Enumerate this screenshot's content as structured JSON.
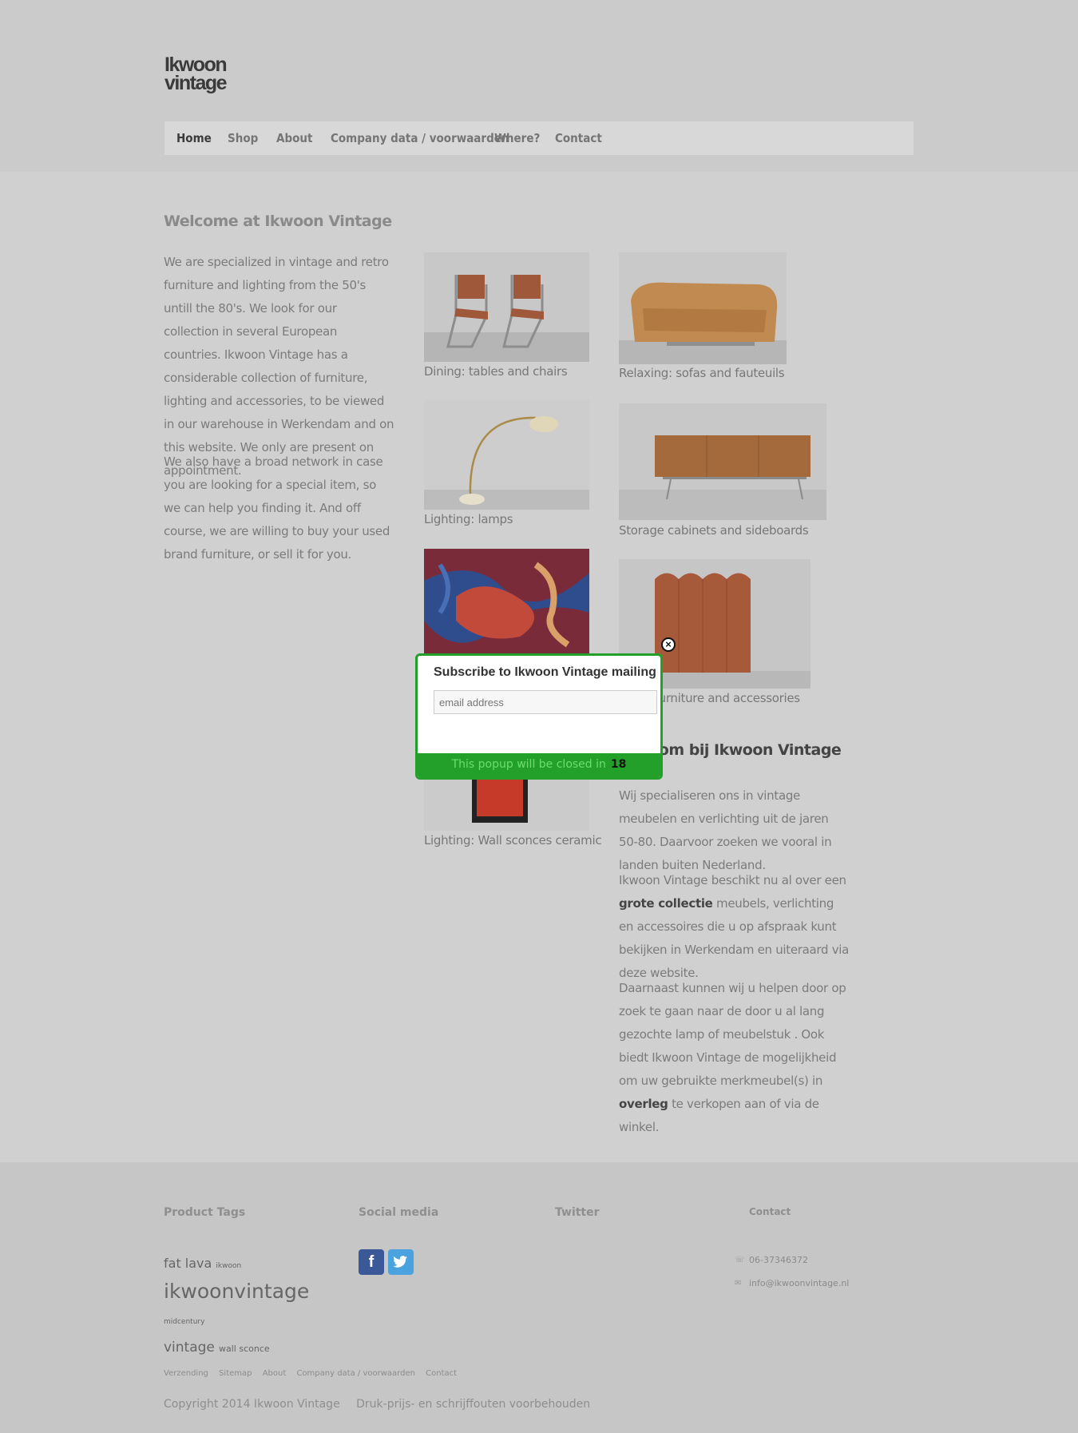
{
  "logo": {
    "line1": "Ikwoon",
    "line2": "vintage"
  },
  "nav": [
    {
      "label": "Home"
    },
    {
      "label": "Shop"
    },
    {
      "label": "About"
    },
    {
      "label": "Company data / voorwaarden"
    },
    {
      "label": "Where?"
    },
    {
      "label": "Contact"
    }
  ],
  "welcome": {
    "title": "Welcome at Ikwoon Vintage",
    "p1": "We are specialized in vintage and retro furniture and lighting from the 50's untill the 80's. We look for our collection in several European countries. Ikwoon Vintage has a considerable collection of furniture, lighting and accessories, to be viewed in our warehouse in Werkendam and on this website. We only are present on appointment.",
    "p2": "We also have a broad network in case you are looking for a special item, so we can help you finding it. And off course, we are willing to buy your used brand furniture, or sell it for you."
  },
  "categories": [
    {
      "label": "Dining: tables and chairs"
    },
    {
      "label": "Relaxing: sofas and fauteuils"
    },
    {
      "label": "Lighting: lamps"
    },
    {
      "label": "Storage cabinets and sideboards"
    },
    {
      "label": ""
    },
    {
      "label": "Small furniture and accessories"
    },
    {
      "label": "Lighting: Wall sconces ceramic"
    }
  ],
  "welkom": {
    "title": "Welkom bij Ikwoon Vintage",
    "p1": "Wij specialiseren ons in vintage meubelen en verlichting uit de jaren 50-80. Daarvoor zoeken we vooral in landen buiten Nederland.",
    "p2_a": "Ikwoon Vintage beschikt nu al over een ",
    "p2_b": "grote collectie",
    "p2_c": " meubels, verlichting en accessoires die u op afspraak kunt bekijken in Werkendam en uiteraard via deze website.",
    "p3_a": "Daarnaast kunnen wij u helpen door op zoek te gaan naar de door u al lang gezochte lamp of meubelstuk . Ook biedt Ikwoon Vintage de mogelijkheid om uw gebruikte merkmeubel(s) in ",
    "p3_b": "overleg",
    "p3_c": " te verkopen aan of via de winkel."
  },
  "footer": {
    "product_tags_title": "Product Tags",
    "social_title": "Social media",
    "twitter_title": "Twitter",
    "contact_title": "Contact",
    "tags": [
      "fat lava",
      "ikwoon",
      "ikwoonvintage",
      "midcentury",
      "vintage",
      "wall sconce"
    ],
    "phone": "06-37346372",
    "email": "info@ikwoonvintage.nl",
    "links": [
      "Verzending",
      "Sitemap",
      "About",
      "Company data / voorwaarden",
      "Contact"
    ],
    "copyright": "Copyright 2014 Ikwoon Vintage",
    "disclaimer": "Druk-prijs- en schrijffouten voorbehouden"
  },
  "popup": {
    "title": "Subscribe to Ikwoon Vintage mailing",
    "placeholder": "email address",
    "closing_text": "This popup will be closed in",
    "countdown": "18",
    "close_glyph": "×"
  },
  "colors": {
    "accent": "#23a02a",
    "facebook": "#3b5998",
    "twitter": "#4aa3df"
  }
}
